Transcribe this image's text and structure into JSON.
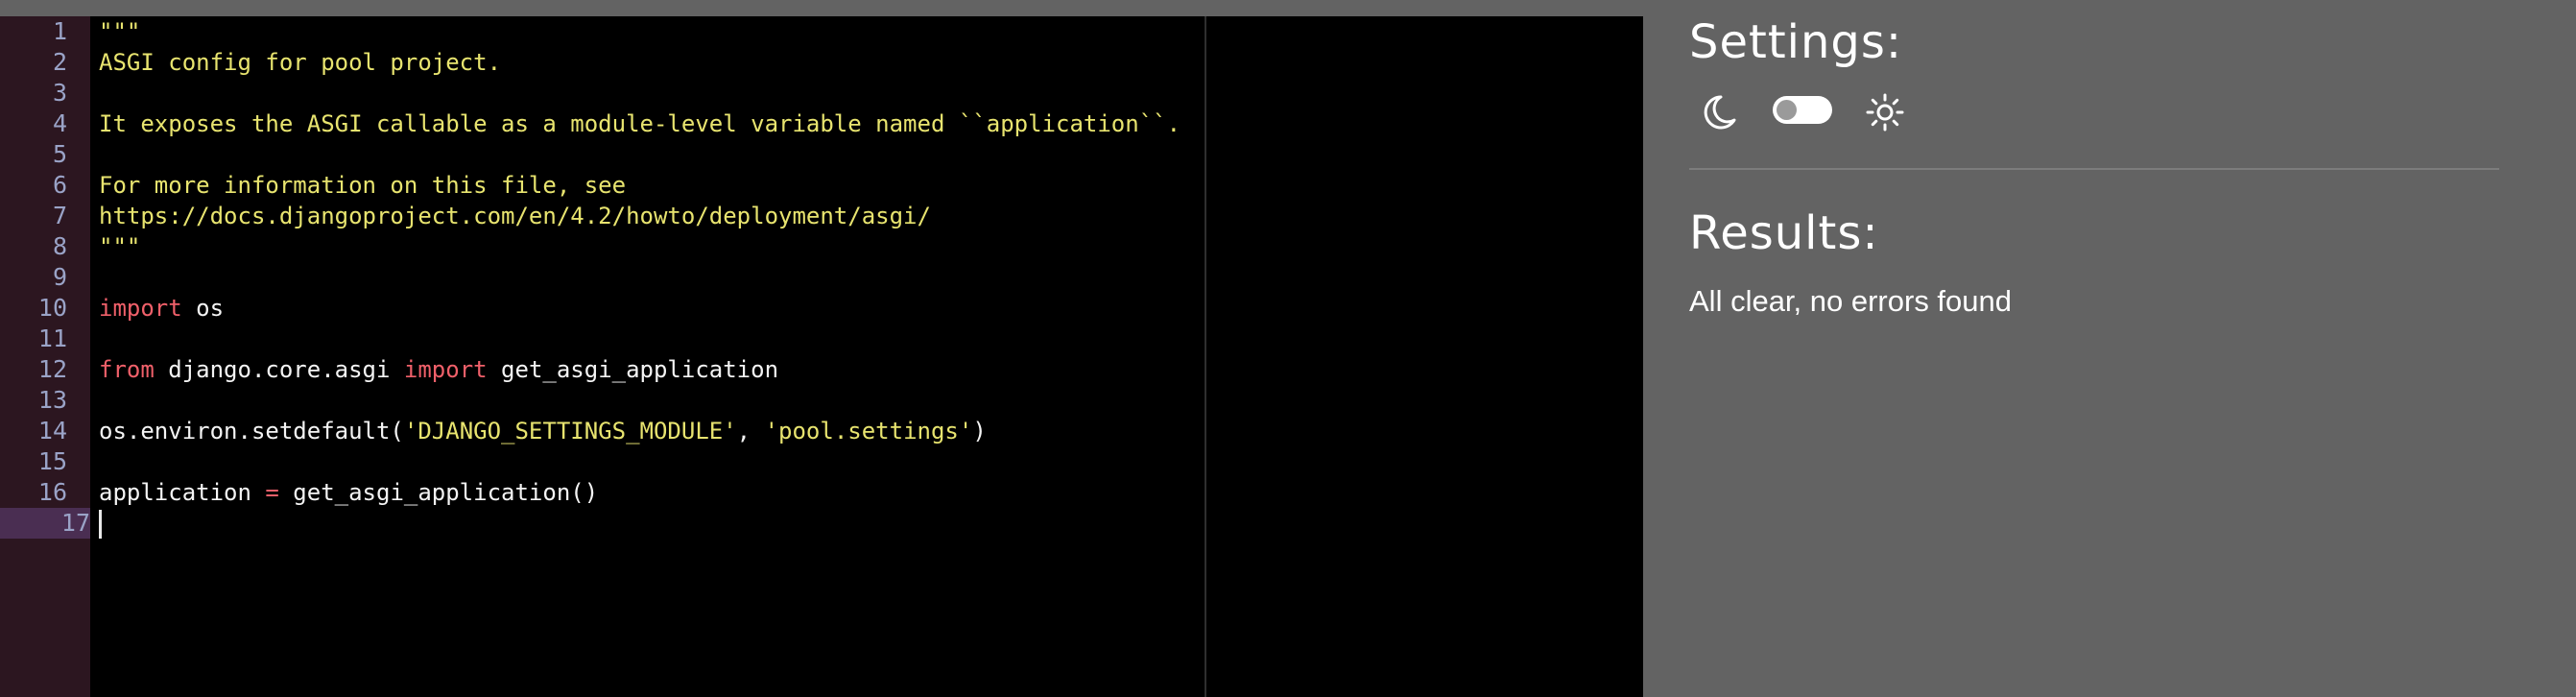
{
  "editor": {
    "line_numbers": [
      "1",
      "2",
      "3",
      "4",
      "5",
      "6",
      "7",
      "8",
      "9",
      "10",
      "11",
      "12",
      "13",
      "14",
      "15",
      "16",
      "17"
    ],
    "lines": [
      [
        {
          "t": "\"\"\"",
          "c": "doc"
        }
      ],
      [
        {
          "t": "ASGI config for pool project.",
          "c": "doc"
        }
      ],
      [],
      [
        {
          "t": "It exposes the ASGI callable as a module-level variable named ``application``.",
          "c": "doc"
        }
      ],
      [],
      [
        {
          "t": "For more information on this file, see",
          "c": "doc"
        }
      ],
      [
        {
          "t": "https://docs.djangoproject.com/en/4.2/howto/deployment/asgi/",
          "c": "doc"
        }
      ],
      [
        {
          "t": "\"\"\"",
          "c": "doc"
        }
      ],
      [],
      [
        {
          "t": "import",
          "c": "kw"
        },
        {
          "t": " os",
          "c": "plain"
        }
      ],
      [],
      [
        {
          "t": "from",
          "c": "kw"
        },
        {
          "t": " django.core.asgi ",
          "c": "plain"
        },
        {
          "t": "import",
          "c": "kw"
        },
        {
          "t": " get_asgi_application",
          "c": "plain"
        }
      ],
      [],
      [
        {
          "t": "os.environ.setdefault(",
          "c": "plain"
        },
        {
          "t": "'DJANGO_SETTINGS_MODULE'",
          "c": "str"
        },
        {
          "t": ", ",
          "c": "plain"
        },
        {
          "t": "'pool.settings'",
          "c": "str"
        },
        {
          "t": ")",
          "c": "plain"
        }
      ],
      [],
      [
        {
          "t": "application ",
          "c": "plain"
        },
        {
          "t": "=",
          "c": "op"
        },
        {
          "t": " get_asgi_application()",
          "c": "plain"
        }
      ],
      []
    ],
    "active_line": 17
  },
  "settings": {
    "title": "Settings:",
    "dark_icon": "moon-icon",
    "light_icon": "sun-icon"
  },
  "results": {
    "title": "Results:",
    "message": "All clear, no errors found"
  },
  "colors": {
    "panel_bg": "#636363",
    "editor_bg": "#000000",
    "gutter_bg": "#2c1620",
    "docstring": "#e8e46f",
    "keyword": "#f0606a"
  }
}
